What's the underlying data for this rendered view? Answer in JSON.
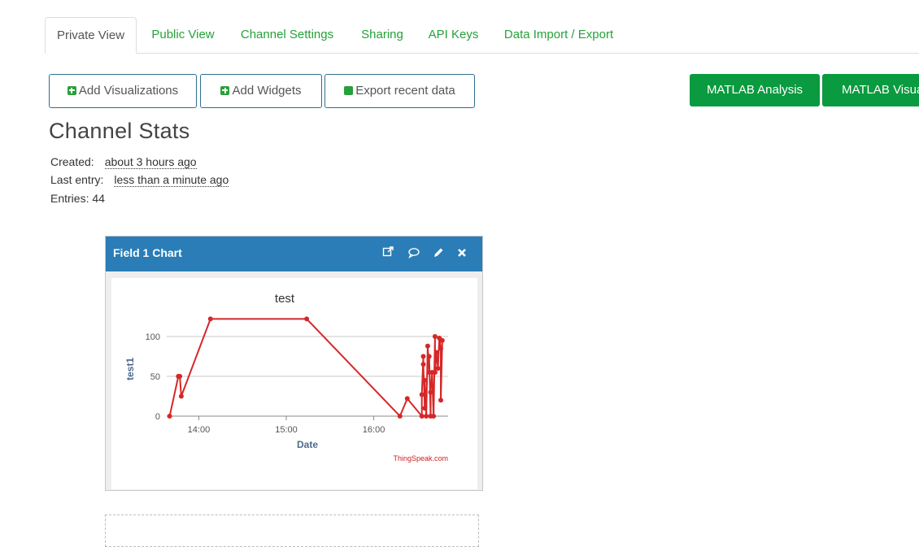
{
  "tabs": [
    {
      "label": "Private View",
      "active": true
    },
    {
      "label": "Public View"
    },
    {
      "label": "Channel Settings"
    },
    {
      "label": "Sharing"
    },
    {
      "label": "API Keys"
    },
    {
      "label": "Data Import / Export"
    }
  ],
  "buttons": {
    "add_visualizations": "Add Visualizations",
    "add_widgets": "Add Widgets",
    "export_recent": "Export recent data",
    "matlab_analysis": "MATLAB Analysis",
    "matlab_visualization": "MATLAB Visua"
  },
  "stats": {
    "title": "Channel Stats",
    "created_label": "Created:",
    "created_value": "about 3 hours ago",
    "last_entry_label": "Last entry:",
    "last_entry_value": "less than a minute ago",
    "entries_label": "Entries: 44"
  },
  "widget": {
    "title": "Field 1 Chart",
    "icons": [
      "external-link-icon",
      "comment-icon",
      "pencil-icon",
      "close-icon"
    ]
  },
  "colors": {
    "accent_green": "#26a139",
    "header_blue": "#2a7db6",
    "line_red": "#d62728"
  },
  "chart_data": {
    "type": "line",
    "title": "test",
    "xlabel": "Date",
    "ylabel": "test1",
    "credit": "ThingSpeak.com",
    "x_ticks": [
      "14:00",
      "15:00",
      "16:00"
    ],
    "y_ticks": [
      0,
      50,
      100
    ],
    "x_tick_minutes": [
      840,
      900,
      960
    ],
    "xlim_minutes": [
      818,
      1011
    ],
    "ylim": [
      0,
      100
    ],
    "points_minutes": [
      [
        820,
        0
      ],
      [
        826,
        50
      ],
      [
        827,
        50
      ],
      [
        828,
        25
      ],
      [
        848,
        122
      ],
      [
        914,
        122
      ],
      [
        978,
        0
      ],
      [
        983,
        22
      ],
      [
        993,
        0
      ],
      [
        993,
        27
      ],
      [
        994,
        75
      ],
      [
        994,
        65
      ],
      [
        995,
        10
      ],
      [
        995,
        45
      ],
      [
        996,
        0
      ],
      [
        997,
        88
      ],
      [
        998,
        55
      ],
      [
        998,
        75
      ],
      [
        999,
        0
      ],
      [
        999,
        30
      ],
      [
        1000,
        55
      ],
      [
        1001,
        0
      ],
      [
        1002,
        100
      ],
      [
        1002,
        55
      ],
      [
        1003,
        80
      ],
      [
        1004,
        60
      ],
      [
        1005,
        98
      ],
      [
        1006,
        85
      ],
      [
        1006,
        20
      ],
      [
        1007,
        95
      ]
    ]
  }
}
